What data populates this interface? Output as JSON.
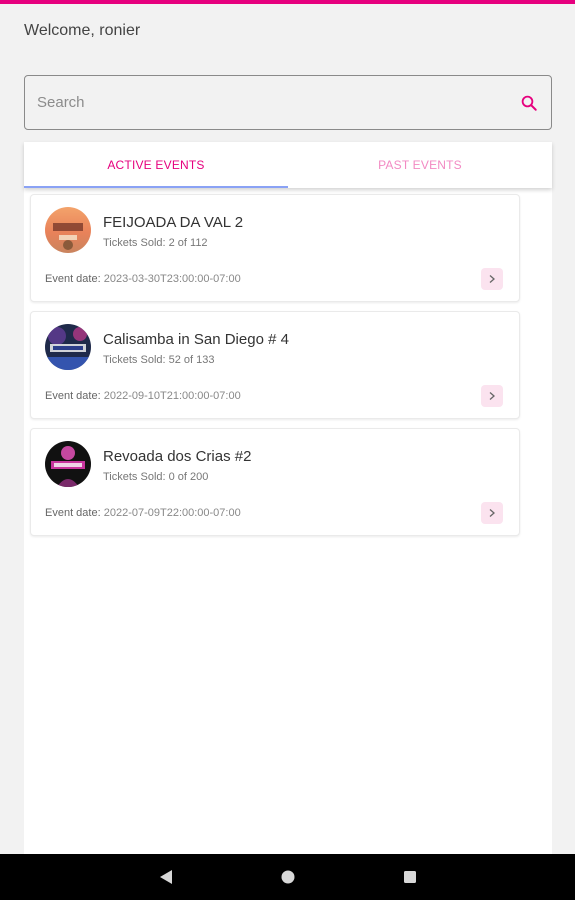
{
  "header": {
    "welcome_text": "Welcome, ronier",
    "accent_color": "#e6007e"
  },
  "search": {
    "placeholder": "Search",
    "value": "",
    "icon": "search-icon"
  },
  "tabs": [
    {
      "label": "ACTIVE EVENTS",
      "active": true
    },
    {
      "label": "PAST EVENTS",
      "active": false
    }
  ],
  "events": [
    {
      "title": "FEIJOADA DA VAL 2",
      "tickets": "Tickets Sold: 2 of 112",
      "date_label": "Event date:",
      "date_value": "2023-03-30T23:00:00-07:00",
      "icon": "chevron-right-icon"
    },
    {
      "title": "Calisamba in San Diego # 4",
      "tickets": "Tickets Sold: 52 of 133",
      "date_label": "Event date:",
      "date_value": "2022-09-10T21:00:00-07:00",
      "icon": "chevron-right-icon"
    },
    {
      "title": "Revoada dos Crias #2",
      "tickets": "Tickets Sold: 0 of 200",
      "date_label": "Event date:",
      "date_value": "2022-07-09T22:00:00-07:00",
      "icon": "chevron-right-icon"
    }
  ],
  "system_nav": {
    "buttons": [
      "back-icon",
      "home-icon",
      "recents-icon"
    ]
  }
}
